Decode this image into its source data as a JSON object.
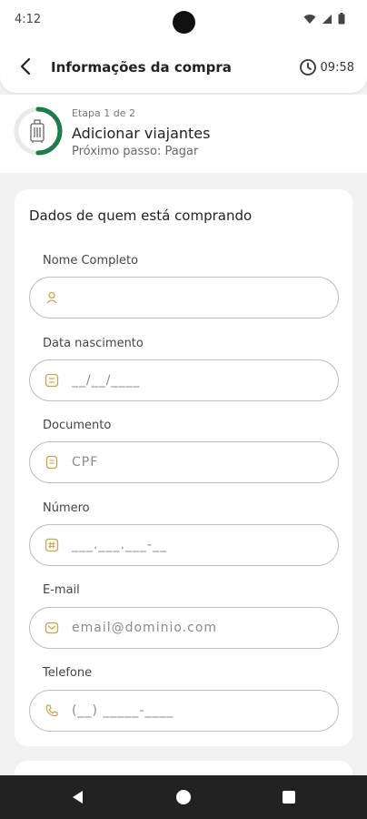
{
  "status": {
    "time": "4:12"
  },
  "header": {
    "title": "Informações da compra",
    "timer": "09:58"
  },
  "stepper": {
    "step_count": "Etapa 1 de 2",
    "step_title": "Adicionar viajantes",
    "next_step": "Próximo passo: Pagar",
    "progress": 0.5
  },
  "form": {
    "title": "Dados de quem está comprando",
    "fields": [
      {
        "label": "Nome Completo",
        "placeholder": "",
        "icon": "person-icon"
      },
      {
        "label": "Data nascimento",
        "placeholder": "__/__/____",
        "icon": "calendar-icon"
      },
      {
        "label": "Documento",
        "placeholder": "CPF",
        "icon": "document-icon"
      },
      {
        "label": "Número",
        "placeholder": "___.___.___-__",
        "icon": "number-icon"
      },
      {
        "label": "E-mail",
        "placeholder": "email@dominio.com",
        "icon": "mail-icon"
      },
      {
        "label": "Telefone",
        "placeholder": "(__) _____-____",
        "icon": "phone-icon"
      }
    ]
  },
  "colors": {
    "accent_green": "#1e7a4f",
    "icon_gold": "#c9a24a"
  }
}
